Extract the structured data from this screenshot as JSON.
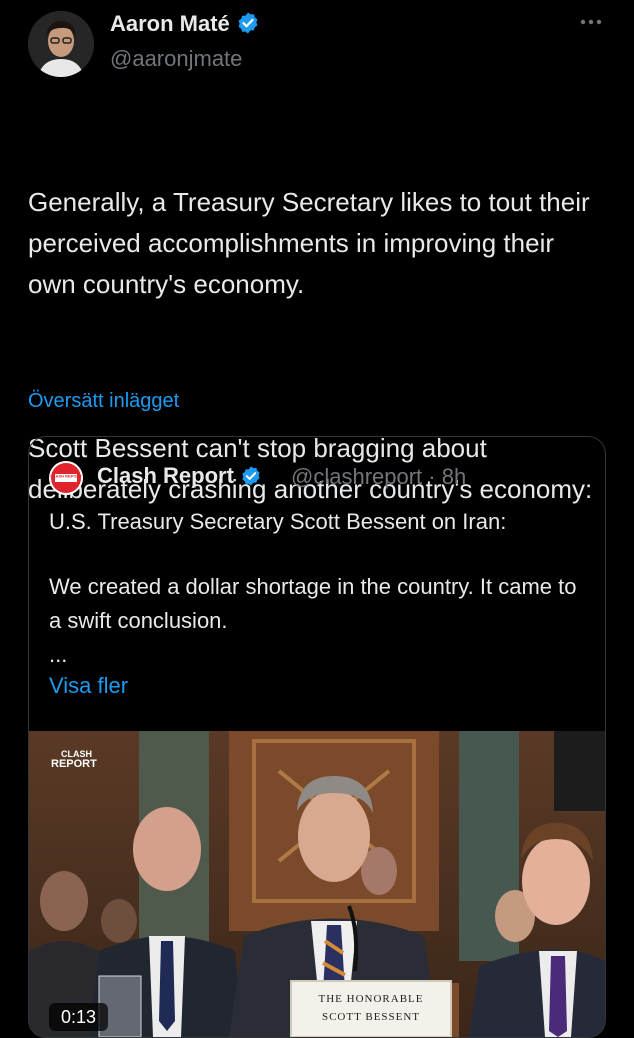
{
  "author": {
    "name": "Aaron Maté",
    "handle": "@aaronjmate"
  },
  "more_icon": "more-horizontal-icon",
  "tweet": {
    "paragraph1": "Generally, a Treasury Secretary likes to tout their perceived accomplishments in improving their own country's economy.",
    "paragraph2": "Scott Bessent can't stop bragging about deliberately crashing another country's economy:",
    "translate_label": "Översätt inlägget"
  },
  "quote": {
    "name": "Clash Report",
    "meta": "@clashreport · 8h",
    "avatar_text": "CLASH REPORT",
    "line1": "U.S. Treasury Secretary Scott Bessent on Iran:",
    "line2": "We created a dollar shortage in the country. It came to a swift conclusion.",
    "ellipsis": "...",
    "show_more": "Visa fler",
    "video": {
      "watermark_line1": "CLASH",
      "watermark_line2": "REPORT",
      "nameplate_line1": "THE HONORABLE",
      "nameplate_line2": "SCOTT BESSENT",
      "time": "0:13"
    }
  },
  "colors": {
    "background": "#000000",
    "text": "#e7e9ea",
    "secondary": "#71767b",
    "link": "#1d9bf0",
    "verified": "#1d9bf0"
  }
}
